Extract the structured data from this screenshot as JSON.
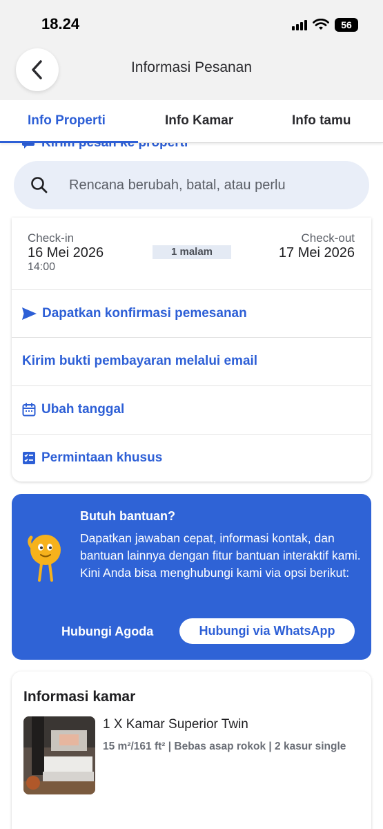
{
  "status_bar": {
    "time": "18.24",
    "battery": "56"
  },
  "header": {
    "title": "Informasi Pesanan"
  },
  "tabs": [
    {
      "label": "Info Properti",
      "active": true
    },
    {
      "label": "Info Kamar",
      "active": false
    },
    {
      "label": "Info tamu",
      "active": false
    }
  ],
  "partial_row": {
    "label": "Kirim pesan ke properti"
  },
  "search": {
    "placeholder": "Rencana berubah, batal, atau perlu"
  },
  "stay": {
    "checkin_label": "Check-in",
    "checkin_date": "16 Mei 2026",
    "checkin_time": "14:00",
    "nights": "1 malam",
    "checkout_label": "Check-out",
    "checkout_date": "17 Mei 2026"
  },
  "actions": [
    {
      "label": "Dapatkan konfirmasi pemesanan",
      "icon": "send-icon"
    },
    {
      "label": "Kirim bukti pembayaran melalui email",
      "icon": ""
    },
    {
      "label": "Ubah tanggal",
      "icon": "calendar-icon"
    },
    {
      "label": "Permintaan khusus",
      "icon": "checklist-icon"
    }
  ],
  "help": {
    "title": "Butuh bantuan?",
    "body": "Dapatkan jawaban cepat, informasi kontak, dan bantuan lainnya dengan fitur bantuan interaktif kami. Kini Anda bisa menghubungi kami via opsi berikut:",
    "contact_agoda": "Hubungi Agoda",
    "contact_whatsapp": "Hubungi via WhatsApp"
  },
  "room": {
    "heading": "Informasi kamar",
    "name": "1 X Kamar Superior Twin",
    "details": "15 m²/161 ft² | Bebas asap rokok | 2 kasur single"
  },
  "colors": {
    "accent": "#2d5fd6",
    "help_bg": "#2f63d6",
    "background": "#f2f2f2"
  }
}
